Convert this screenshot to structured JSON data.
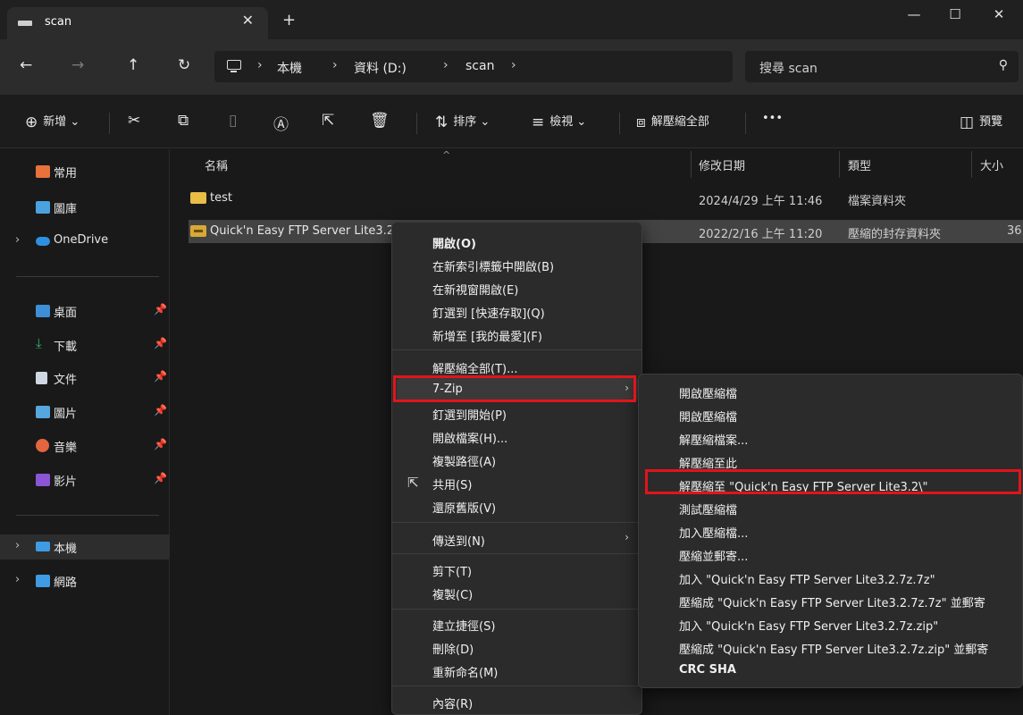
{
  "window": {
    "tab_title": "scan",
    "tab_close": "✕",
    "new_tab": "+",
    "minimize": "—",
    "maximize": "☐",
    "close": "✕"
  },
  "nav": {
    "back": "←",
    "forward": "→",
    "up": "↑",
    "refresh": "↻",
    "breadcrumbs": [
      "本機",
      "資料 (D:)",
      "scan"
    ],
    "separator": "›",
    "search_placeholder": "搜尋 scan"
  },
  "commands": {
    "new": "新增",
    "sort": "排序",
    "view": "檢視",
    "extract_all": "解壓縮全部",
    "more": "•••",
    "preview": "預覽"
  },
  "sidebar": {
    "items": [
      {
        "label": "常用",
        "icon": "home-icon",
        "color": "#e8713c"
      },
      {
        "label": "圖庫",
        "icon": "gallery-icon",
        "color": "#4aa3df"
      },
      {
        "label": "OneDrive",
        "icon": "cloud-icon",
        "color": "#2f8fe0"
      },
      {
        "label": "桌面",
        "icon": "desktop-icon",
        "color": "#3d8fd6"
      },
      {
        "label": "下載",
        "icon": "download-icon",
        "color": "#3ab06a"
      },
      {
        "label": "文件",
        "icon": "document-icon",
        "color": "#cfd8e2"
      },
      {
        "label": "圖片",
        "icon": "pictures-icon",
        "color": "#56a6e0"
      },
      {
        "label": "音樂",
        "icon": "music-icon",
        "color": "#e2653f"
      },
      {
        "label": "影片",
        "icon": "video-icon",
        "color": "#8b55d6"
      },
      {
        "label": "本機",
        "icon": "pc-icon",
        "color": "#3f9be3"
      },
      {
        "label": "網路",
        "icon": "network-icon",
        "color": "#3f9be3"
      }
    ]
  },
  "filelist": {
    "columns": [
      "名稱",
      "修改日期",
      "類型",
      "大小"
    ],
    "rows": [
      {
        "name": "test",
        "date": "2024/4/29 上午 11:46",
        "type": "檔案資料夾",
        "size": ""
      },
      {
        "name": "Quick'n Easy FTP Server Lite3.2.7z",
        "date": "2022/2/16 上午 11:20",
        "type": "壓縮的封存資料夾",
        "size": "36"
      }
    ]
  },
  "context_menu": {
    "items": [
      "開啟(O)",
      "在新索引標籤中開啟(B)",
      "在新視窗開啟(E)",
      "釘選到 [快速存取](Q)",
      "新增至 [我的最愛](F)",
      "解壓縮全部(T)...",
      "7-Zip",
      "釘選到開始(P)",
      "開啟檔案(H)...",
      "複製路徑(A)",
      "共用(S)",
      "還原舊版(V)",
      "傳送到(N)",
      "剪下(T)",
      "複製(C)",
      "建立捷徑(S)",
      "刪除(D)",
      "重新命名(M)",
      "內容(R)"
    ]
  },
  "submenu": {
    "items": [
      "開啟壓縮檔",
      "開啟壓縮檔",
      "解壓縮檔案...",
      "解壓縮至此",
      "解壓縮至 \"Quick'n Easy FTP Server Lite3.2\\\"",
      "測試壓縮檔",
      "加入壓縮檔...",
      "壓縮並郵寄...",
      "加入 \"Quick'n Easy FTP Server Lite3.2.7z.7z\"",
      "壓縮成 \"Quick'n Easy FTP Server Lite3.2.7z.7z\" 並郵寄",
      "加入 \"Quick'n Easy FTP Server Lite3.2.7z.zip\"",
      "壓縮成 \"Quick'n Easy FTP Server Lite3.2.7z.zip\" 並郵寄",
      "CRC SHA"
    ]
  },
  "colors": {
    "highlight": "#e0151b",
    "folder": "#e9bd46"
  }
}
